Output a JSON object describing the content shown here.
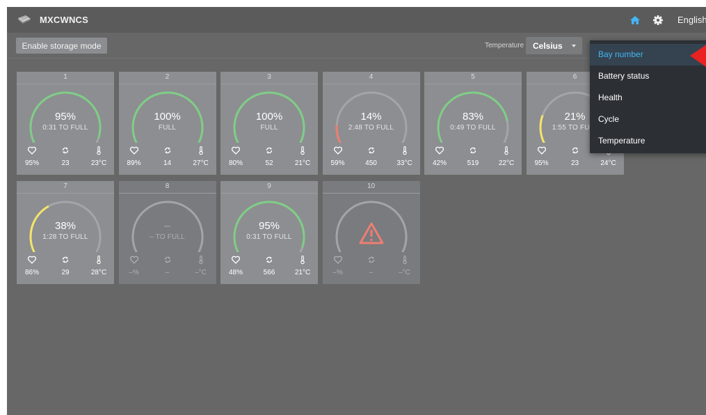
{
  "app": {
    "title": "MXCWNCS",
    "language": "English",
    "storage_button_label": "Enable storage mode"
  },
  "temperature": {
    "label": "Temperature",
    "selected": "Celsius"
  },
  "menu": {
    "items": [
      "Bay number",
      "Battery status",
      "Health",
      "Cycle",
      "Temperature"
    ],
    "active_index": 0
  },
  "colors": {
    "green": "#7fcd86",
    "yellow": "#f4e36a",
    "red": "#ee7e72",
    "track": "#a3a5a8",
    "accent": "#45b4f4",
    "pointer": "#ea2222"
  },
  "bays": [
    {
      "number": "1",
      "percent": "95%",
      "status": "0:31 TO FULL",
      "health": "95%",
      "cycles": "23",
      "temp": "23°C",
      "level": 0.95,
      "color": "green"
    },
    {
      "number": "2",
      "percent": "100%",
      "status": "FULL",
      "health": "89%",
      "cycles": "14",
      "temp": "27°C",
      "level": 1.0,
      "color": "green"
    },
    {
      "number": "3",
      "percent": "100%",
      "status": "FULL",
      "health": "80%",
      "cycles": "52",
      "temp": "21°C",
      "level": 1.0,
      "color": "green"
    },
    {
      "number": "4",
      "percent": "14%",
      "status": "2:48 TO FULL",
      "health": "59%",
      "cycles": "450",
      "temp": "33°C",
      "level": 0.14,
      "color": "red"
    },
    {
      "number": "5",
      "percent": "83%",
      "status": "0:49 TO FULL",
      "health": "42%",
      "cycles": "519",
      "temp": "22°C",
      "level": 0.83,
      "color": "green"
    },
    {
      "number": "6",
      "percent": "21%",
      "status": "1:55 TO FULL",
      "health": "95%",
      "cycles": "23",
      "temp": "24°C",
      "level": 0.21,
      "color": "yellow"
    },
    {
      "number": "7",
      "percent": "38%",
      "status": "1:28 TO FULL",
      "health": "86%",
      "cycles": "29",
      "temp": "28°C",
      "level": 0.38,
      "color": "yellow"
    },
    {
      "number": "8",
      "percent": "–",
      "status": "– TO FULL",
      "health": "–%",
      "cycles": "–",
      "temp": "–°C",
      "level": 0,
      "color": "none",
      "empty": true
    },
    {
      "number": "9",
      "percent": "95%",
      "status": "0:31 TO FULL",
      "health": "48%",
      "cycles": "566",
      "temp": "21°C",
      "level": 0.95,
      "color": "green"
    },
    {
      "number": "10",
      "percent": "",
      "status": "",
      "health": "–%",
      "cycles": "–",
      "temp": "–°C",
      "level": 0,
      "color": "none",
      "empty": true,
      "error": true
    }
  ]
}
